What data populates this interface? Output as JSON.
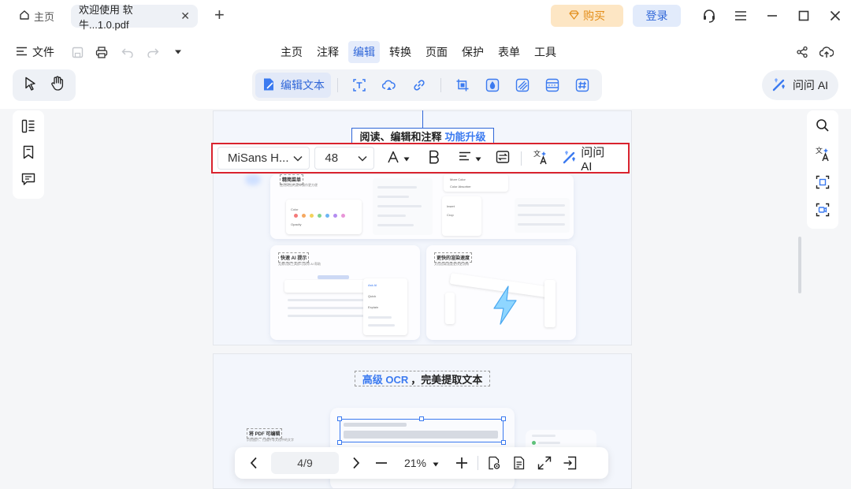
{
  "titlebar": {
    "home_tab": "主页",
    "doc_tab": "欢迎使用 软牛...1.0.pdf",
    "new_tab": "+",
    "buy": "购买",
    "login": "登录"
  },
  "menubar": {
    "file": "文件",
    "items": [
      "主页",
      "注释",
      "编辑",
      "转换",
      "页面",
      "保护",
      "表单",
      "工具"
    ],
    "active": "编辑"
  },
  "edit_toolbar": {
    "edit_text": "编辑文本"
  },
  "ask_ai": "问问 AI",
  "format_bar": {
    "font": "MiSans H...",
    "size": "48",
    "ask_ai": "问问 AI"
  },
  "page1": {
    "heading": "阅读、编辑和注释",
    "heading_highlight": "功能升级",
    "cards": [
      {
        "title": "精简菜单",
        "sub": "使用简洁的菜单操作更方便"
      },
      {
        "title": "快速 AI 提示",
        "sub": "无需切换工具即可获得 AI 帮助"
      },
      {
        "title": "更快的渲染速度",
        "sub": "文档加载速度更快更流畅"
      }
    ],
    "menu_texts": [
      "Color",
      "Opacity",
      "More Color",
      "Color Absorber",
      "Insert",
      "Crop",
      "Ask AI",
      "Quick",
      "Explain"
    ]
  },
  "page2": {
    "heading_highlight": "高级 OCR",
    "heading": "，完美提取文本",
    "left_label": "将 PDF 可编辑",
    "left_sub": "识别图片、扫描件等文档中的文字"
  },
  "bottom_nav": {
    "page": "4/9",
    "zoom": "21%"
  }
}
